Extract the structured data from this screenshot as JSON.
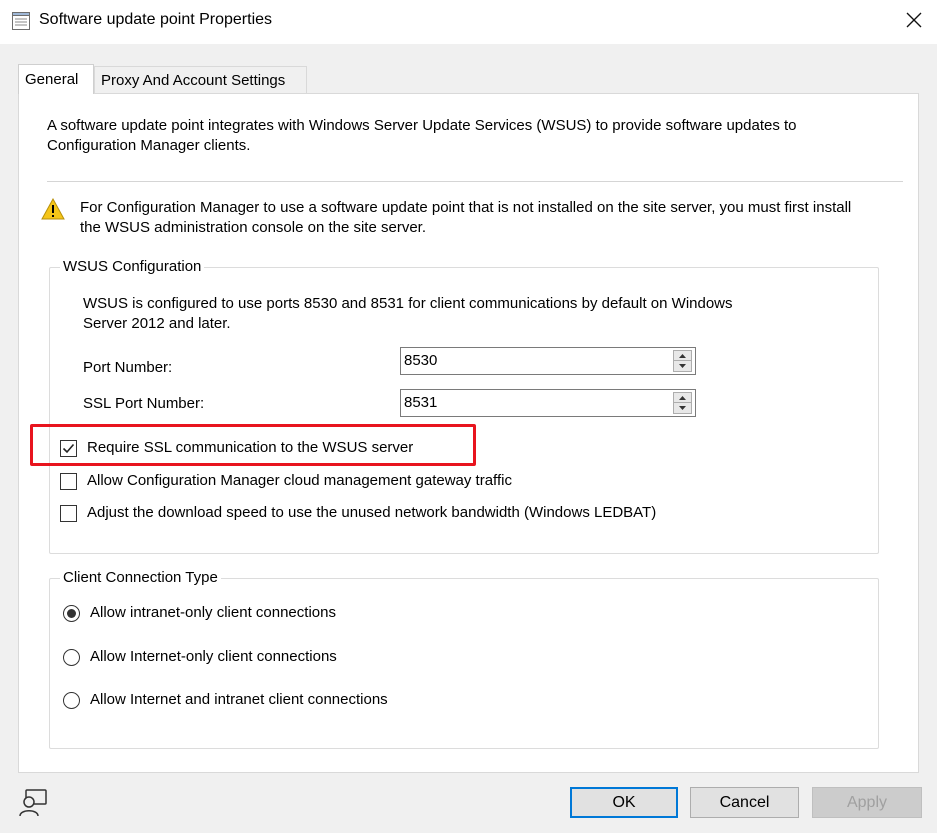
{
  "window": {
    "title": "Software update point Properties",
    "icon": "properties-sheet-icon",
    "close_icon": "close-icon"
  },
  "tabs": [
    {
      "label": "General",
      "selected": true
    },
    {
      "label": "Proxy And Account Settings",
      "selected": false
    }
  ],
  "general": {
    "intro_line1": "A software update point integrates with Windows Server Update Services (WSUS) to provide software updates to",
    "intro_line2": "Configuration Manager clients.",
    "warning_icon": "warning-icon",
    "warning_line1": "For Configuration Manager to use a software update point that is not installed on the site server, you must first install",
    "warning_line2": "the WSUS administration console on the site server."
  },
  "wsus": {
    "title": "WSUS Configuration",
    "desc_line1": "WSUS is configured to use ports 8530 and 8531 for client communications by default on Windows",
    "desc_line2": "Server 2012 and later.",
    "port_label": "Port Number:",
    "port_value": "8530",
    "ssl_port_label": "SSL Port Number:",
    "ssl_port_value": "8531",
    "require_ssl_label": "Require SSL communication to the WSUS server",
    "require_ssl_checked": true,
    "cmg_label": "Allow Configuration Manager cloud management gateway traffic",
    "cmg_checked": false,
    "ledbat_label": "Adjust the download speed to use the unused network bandwidth (Windows LEDBAT)",
    "ledbat_checked": false
  },
  "client_connection": {
    "title": "Client Connection Type",
    "options": [
      {
        "label": "Allow intranet-only client connections",
        "selected": true
      },
      {
        "label": "Allow Internet-only client connections",
        "selected": false
      },
      {
        "label": "Allow Internet and intranet client connections",
        "selected": false
      }
    ]
  },
  "buttons": {
    "ok": "OK",
    "cancel": "Cancel",
    "apply": "Apply"
  },
  "colors": {
    "highlight": "#e8141e",
    "default_button_border": "#0078d7"
  }
}
